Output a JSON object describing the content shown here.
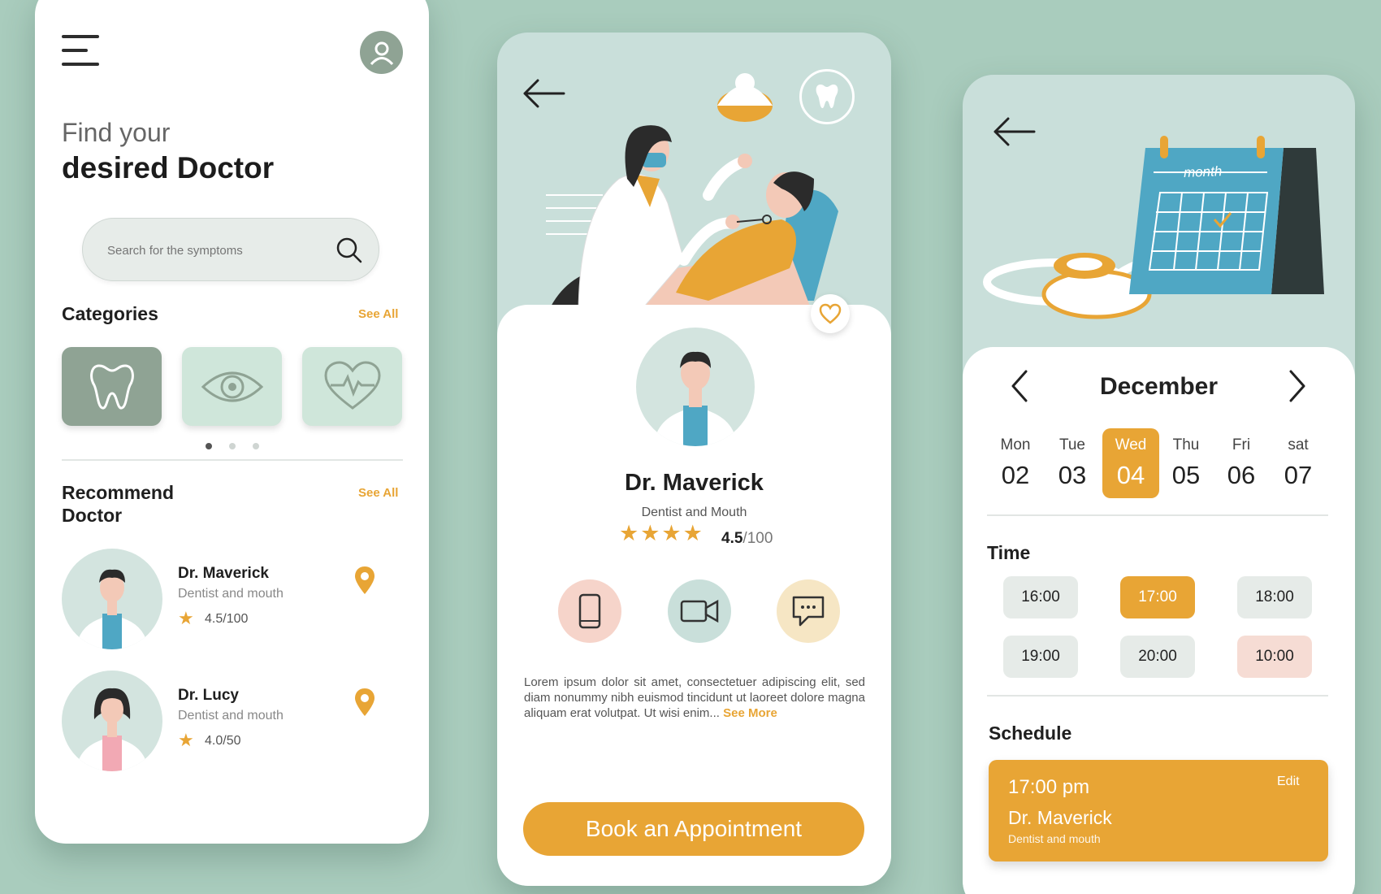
{
  "screen1": {
    "heading_light": "Find your",
    "heading_bold": "desired Doctor",
    "search_placeholder": "Search for the symptoms",
    "categories_title": "Categories",
    "categories_see_all": "See All",
    "categories": [
      {
        "icon": "tooth-icon"
      },
      {
        "icon": "eye-icon"
      },
      {
        "icon": "heart-pulse-icon"
      }
    ],
    "recommend_title_1": "Recommend",
    "recommend_title_2": "Doctor",
    "recommend_see_all": "See All",
    "doctors": [
      {
        "name": "Dr. Maverick",
        "specialty": "Dentist and mouth",
        "rating": "4.5/100"
      },
      {
        "name": "Dr. Lucy",
        "specialty": "Dentist and mouth",
        "rating": "4.0/50"
      }
    ]
  },
  "screen2": {
    "doctor_name": "Dr. Maverick",
    "specialty": "Dentist and Mouth",
    "stars": 4,
    "rating_value": "4.5",
    "rating_scale": "/100",
    "description": "Lorem ipsum dolor sit amet, consectetuer adipiscing elit, sed diam nonummy nibh euismod tincidunt ut laoreet dolore magna aliquam erat volutpat. Ut wisi enim...",
    "see_more": "See More",
    "book_button": "Book an Appointment",
    "contact_icons": [
      "phone-icon",
      "video-camera-icon",
      "chat-icon"
    ]
  },
  "screen3": {
    "calendar_word": "month",
    "month": "December",
    "days": [
      {
        "name": "Mon",
        "num": "02"
      },
      {
        "name": "Tue",
        "num": "03"
      },
      {
        "name": "Wed",
        "num": "04"
      },
      {
        "name": "Thu",
        "num": "05"
      },
      {
        "name": "Fri",
        "num": "06"
      },
      {
        "name": "sat",
        "num": "07"
      }
    ],
    "time_title": "Time",
    "times": [
      "16:00",
      "17:00",
      "18:00",
      "19:00",
      "20:00",
      "10:00"
    ],
    "schedule_title": "Schedule",
    "schedule": {
      "time": "17:00 pm",
      "edit": "Edit",
      "doctor": "Dr. Maverick",
      "specialty": "Dentist and mouth"
    }
  },
  "colors": {
    "accent": "#e8a535",
    "sage": "#8fa394",
    "mint": "#cfe6da",
    "background": "#a9ccbd"
  }
}
